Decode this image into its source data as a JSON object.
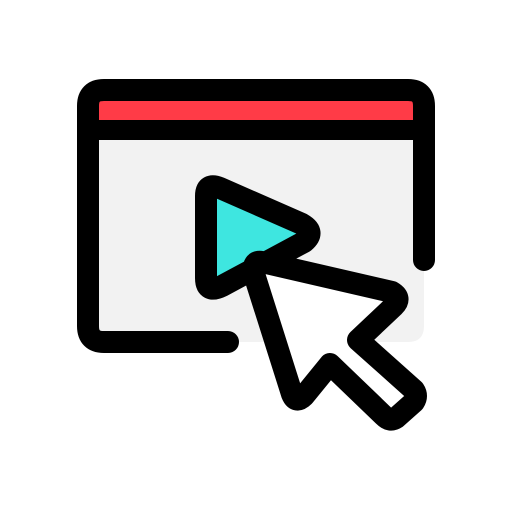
{
  "icon": {
    "name": "video-play-click-icon",
    "parts": [
      "browser-window-icon",
      "play-button-icon",
      "mouse-cursor-icon"
    ]
  },
  "colors": {
    "outline": "#000000",
    "window_bar": "#ff3b47",
    "window_body": "#f2f2f2",
    "play": "#3ee6e0",
    "cursor": "#ffffff",
    "background": "#ffffff"
  }
}
